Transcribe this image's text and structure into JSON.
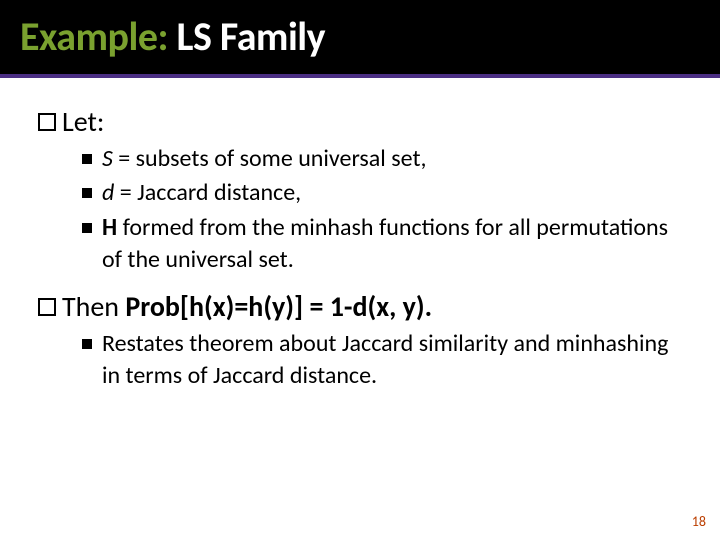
{
  "title": {
    "accent": "Example:",
    "rest": " LS Family"
  },
  "lvl1": {
    "let": "Let:",
    "then_prefix": "Then ",
    "then_eq": "Prob[h(x)=h(y)] = 1-d(x, y)."
  },
  "let_items": [
    {
      "sym": "S",
      "rest": " = subsets of some universal set,"
    },
    {
      "sym": "d",
      "rest": " = Jaccard distance,"
    },
    {
      "sym": "H",
      "rest": " formed from the minhash functions for all permutations of the universal set."
    }
  ],
  "then_items": [
    "Restates theorem about Jaccard similarity and minhashing in terms of Jaccard distance."
  ],
  "page_number": "18"
}
